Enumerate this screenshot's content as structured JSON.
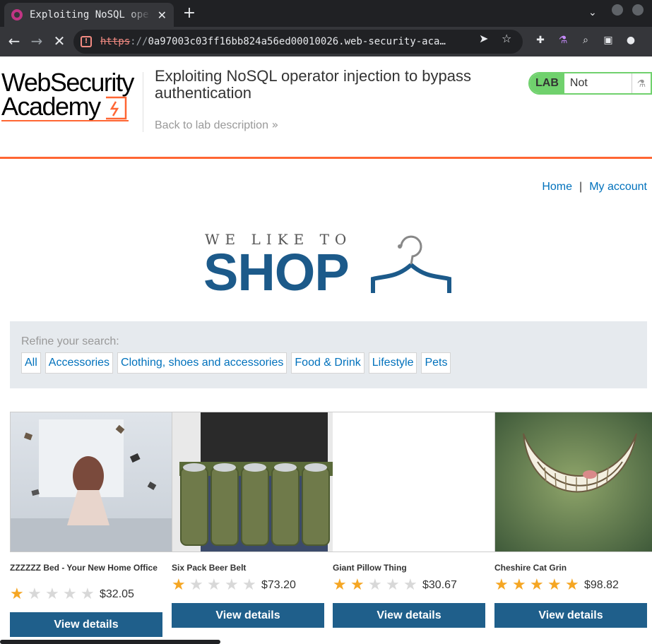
{
  "browser": {
    "tab_title": "Exploiting NoSQL operator injection to bypass authentication",
    "tab_close": "✕",
    "new_tab": "+",
    "url_scheme": "https",
    "url_sep": "://",
    "url_rest": "0a97003c03ff16bb824a56ed00010026.web-security-aca…"
  },
  "header": {
    "logo_line1": "WebSecurity",
    "logo_line2": "Academy",
    "lab_title": "Exploiting NoSQL operator injection to bypass authentication",
    "back_link": "Back to lab description",
    "lab_tag": "LAB",
    "lab_status": "Not solved"
  },
  "nav": {
    "home": "Home",
    "separator": "|",
    "account": "My account"
  },
  "shop_logo": {
    "top": "WE LIKE TO",
    "main": "SHOP"
  },
  "search": {
    "label": "Refine your search:",
    "filters": [
      "All",
      "Accessories",
      "Clothing, shoes and accessories",
      "Food & Drink",
      "Lifestyle",
      "Pets"
    ]
  },
  "products": [
    {
      "name": "ZZZZZZ Bed - Your New Home Office",
      "rating": 1,
      "price": "$32.05",
      "button": "View details"
    },
    {
      "name": "Six Pack Beer Belt",
      "rating": 1,
      "price": "$73.20",
      "button": "View details"
    },
    {
      "name": "Giant Pillow Thing",
      "rating": 2,
      "price": "$30.67",
      "button": "View details"
    },
    {
      "name": "Cheshire Cat Grin",
      "rating": 5,
      "price": "$98.82",
      "button": "View details"
    }
  ],
  "colors": {
    "accent": "#ff6633",
    "lab_green": "#70d16d",
    "link_blue": "#0071bc",
    "button_blue": "#1f5f8b",
    "star_gold": "#f5a623"
  }
}
